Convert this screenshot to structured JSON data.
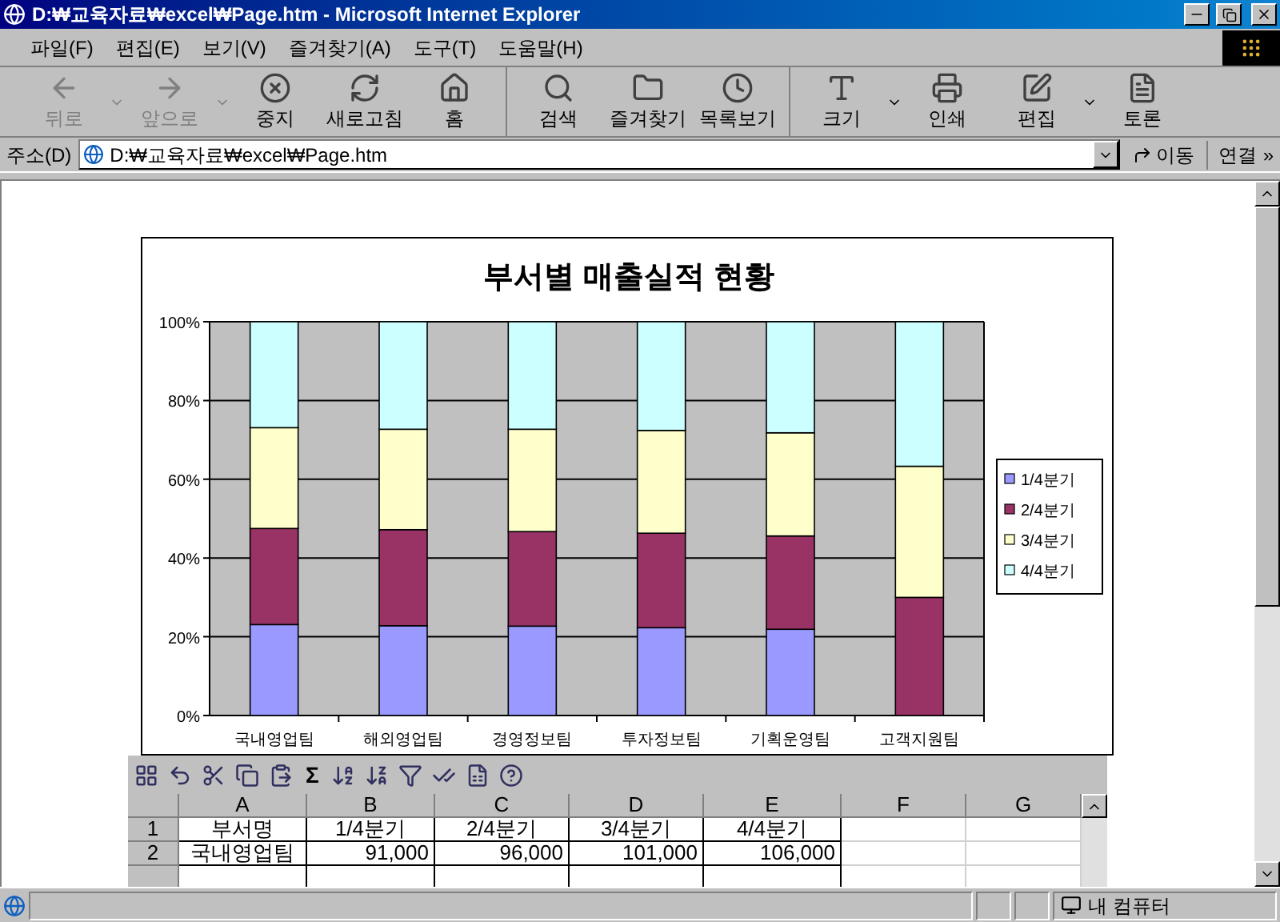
{
  "window": {
    "title": "D:₩교육자료₩excel₩Page.htm - Microsoft Internet Explorer"
  },
  "menu": [
    "파일(F)",
    "편집(E)",
    "보기(V)",
    "즐겨찾기(A)",
    "도구(T)",
    "도움말(H)"
  ],
  "toolbar": {
    "groups": [
      [
        {
          "label": "뒤로",
          "disabled": true,
          "has_menu": true
        },
        {
          "label": "앞으로",
          "disabled": true,
          "has_menu": true
        },
        {
          "label": "중지",
          "disabled": false,
          "has_menu": false
        },
        {
          "label": "새로고침",
          "disabled": false,
          "has_menu": false
        },
        {
          "label": "홈",
          "disabled": false,
          "has_menu": false
        }
      ],
      [
        {
          "label": "검색",
          "disabled": false,
          "has_menu": false
        },
        {
          "label": "즐겨찾기",
          "disabled": false,
          "has_menu": false
        },
        {
          "label": "목록보기",
          "disabled": false,
          "has_menu": false
        }
      ],
      [
        {
          "label": "크기",
          "disabled": false,
          "has_menu": true
        },
        {
          "label": "인쇄",
          "disabled": false,
          "has_menu": false
        },
        {
          "label": "편집",
          "disabled": false,
          "has_menu": true
        },
        {
          "label": "토론",
          "disabled": false,
          "has_menu": false
        }
      ]
    ]
  },
  "address_bar": {
    "label": "주소(D)",
    "value": "D:₩교육자료₩excel₩Page.htm",
    "go": "이동",
    "links": "연결",
    "more": "»"
  },
  "chart": {
    "chart_data": {
      "type": "bar",
      "title": "부서별 매출실적 현황",
      "stacked": true,
      "grid": true,
      "legend": true,
      "categories": [
        "국내영업팀",
        "해외영업팀",
        "경영정보팀",
        "투자정보팀",
        "기획운영팀",
        "고객지원팀"
      ],
      "ylim": [
        0,
        100
      ],
      "yticks": [
        {
          "value": 0,
          "label": "0%"
        },
        {
          "value": 20,
          "label": "20%"
        },
        {
          "value": 40,
          "label": "40%"
        },
        {
          "value": 60,
          "label": "60%"
        },
        {
          "value": 80,
          "label": "80%"
        },
        {
          "value": 100,
          "label": "100%"
        }
      ],
      "series": [
        {
          "name": "1/4분기",
          "color": "#9999ff",
          "values": [
            23.1,
            22.8,
            22.7,
            22.3,
            21.9,
            0
          ]
        },
        {
          "name": "2/4분기",
          "color": "#993366",
          "values": [
            24.4,
            24.4,
            24,
            24,
            23.7,
            30
          ]
        },
        {
          "name": "3/4분기",
          "color": "#ffffcc",
          "values": [
            25.6,
            25.5,
            26,
            26.1,
            26.2,
            33.3
          ]
        },
        {
          "name": "4/4분기",
          "color": "#ccffff",
          "values": [
            26.9,
            27.3,
            27.3,
            27.6,
            28.2,
            36.7
          ]
        }
      ]
    }
  },
  "sheet": {
    "sum_symbol": "Σ",
    "columns": [
      "",
      "A",
      "B",
      "C",
      "D",
      "E",
      "F",
      "G"
    ],
    "rows": [
      [
        "1",
        "부서명",
        "1/4분기",
        "2/4분기",
        "3/4분기",
        "4/4분기"
      ],
      [
        "2",
        "국내영업팀",
        "91,000",
        "96,000",
        "101,000",
        "106,000"
      ]
    ]
  },
  "status_bar": {
    "zone": "내 컴퓨터"
  }
}
